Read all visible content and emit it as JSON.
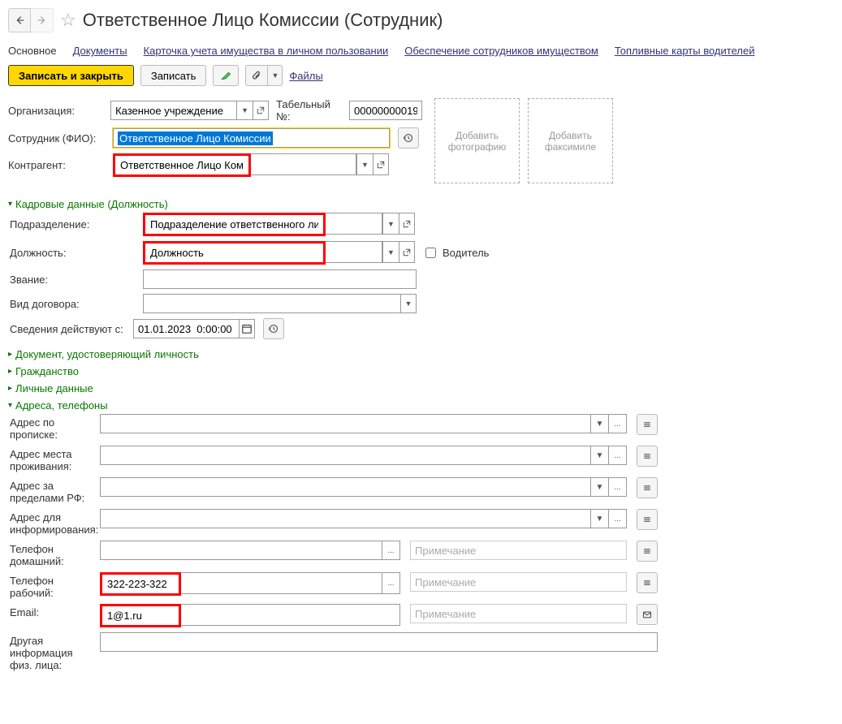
{
  "header": {
    "title": "Ответственное Лицо Комиссии (Сотрудник)"
  },
  "tabs": {
    "main": "Основное",
    "docs": "Документы",
    "card": "Карточка учета имущества в личном пользовании",
    "supply": "Обеспечение сотрудников имуществом",
    "fuel": "Топливные карты водителей"
  },
  "toolbar": {
    "write_close": "Записать и закрыть",
    "write": "Записать",
    "files": "Файлы"
  },
  "form": {
    "org_label": "Организация:",
    "org_value": "Казенное учреждение",
    "tabel_label": "Табельный №:",
    "tabel_value": "00000000019",
    "employee_label": "Сотрудник (ФИО):",
    "employee_value": "Ответственное Лицо Комиссии",
    "counterparty_label": "Контрагент:",
    "counterparty_value": "Ответственное Лицо Комиссии",
    "add_photo": "Добавить фотографию",
    "add_fax": "Добавить факсимиле"
  },
  "sections": {
    "hr": "Кадровые данные (Должность)",
    "identity": "Документ, удостоверяющий личность",
    "citizenship": "Гражданство",
    "personal": "Личные данные",
    "addresses": "Адреса, телефоны"
  },
  "hr": {
    "dept_label": "Подразделение:",
    "dept_value": "Подразделение ответственного лица",
    "position_label": "Должность:",
    "position_value": "Должность",
    "driver_label": "Водитель",
    "rank_label": "Звание:",
    "contract_label": "Вид договора:",
    "valid_from_label": "Сведения действуют с:",
    "valid_from_value": "01.01.2023  0:00:00"
  },
  "addr": {
    "reg": "Адрес по прописке:",
    "live": "Адрес места проживания:",
    "foreign": "Адрес за пределами РФ:",
    "info": "Адрес для информирования:",
    "home_phone": "Телефон домашний:",
    "work_phone": "Телефон рабочий:",
    "work_phone_value": "322-223-322",
    "email": "Email:",
    "email_value": "1@1.ru",
    "other": "Другая информация физ. лица:",
    "note_ph": "Примечание",
    "ellipsis": "..."
  }
}
